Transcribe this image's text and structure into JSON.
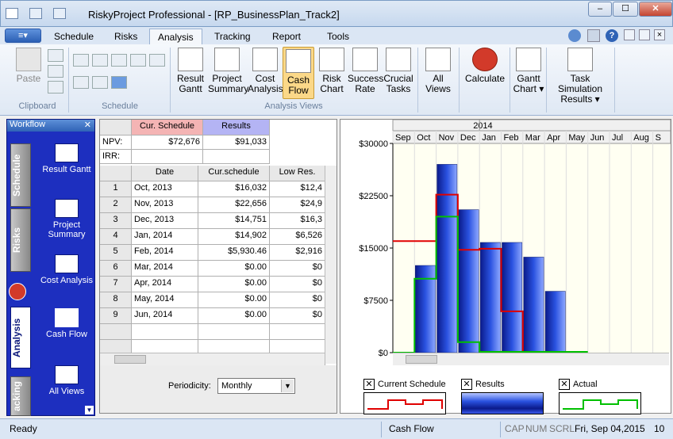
{
  "window": {
    "title": "RiskyProject Professional - [RP_BusinessPlan_Track2]",
    "minimize": "–",
    "maximize": "☐",
    "close": "✕"
  },
  "tabs": [
    "Schedule",
    "Risks",
    "Analysis",
    "Tracking",
    "Report",
    "Tools"
  ],
  "ribbon": {
    "clipboard": {
      "paste": "Paste",
      "group": "Clipboard"
    },
    "schedule_group": "Schedule",
    "views": [
      {
        "l1": "Result",
        "l2": "Gantt"
      },
      {
        "l1": "Project",
        "l2": "Summary"
      },
      {
        "l1": "Cost",
        "l2": "Analysis"
      },
      {
        "l1": "Cash",
        "l2": "Flow"
      },
      {
        "l1": "Risk",
        "l2": "Chart"
      },
      {
        "l1": "Success",
        "l2": "Rate"
      },
      {
        "l1": "Crucial",
        "l2": "Tasks"
      },
      {
        "l1": "All",
        "l2": "Views"
      }
    ],
    "views_group": "Analysis Views",
    "calculate": "Calculate",
    "gantt_chart": {
      "l1": "Gantt",
      "l2": "Chart ▾"
    },
    "task_sim": {
      "l1": "Task Simulation",
      "l2": "Results ▾"
    }
  },
  "workflow": {
    "title": "Workflow",
    "close": "✕",
    "vtabs": [
      "Schedule",
      "Risks",
      "Analysis",
      "acking"
    ],
    "items": [
      "Result Gantt",
      "Project Summary",
      "Cost Analysis",
      "Cash Flow",
      "All Views"
    ]
  },
  "summary": {
    "col1": "Cur. Schedule",
    "col2": "Results",
    "npv_label": "NPV:",
    "npv_cur": "$72,676",
    "npv_res": "$91,033",
    "irr_label": "IRR:"
  },
  "table": {
    "headers": [
      "Date",
      "Cur.schedule",
      "Low Res."
    ],
    "rows": [
      [
        "1",
        "Oct, 2013",
        "$16,032",
        "$12,4"
      ],
      [
        "2",
        "Nov, 2013",
        "$22,656",
        "$24,9"
      ],
      [
        "3",
        "Dec, 2013",
        "$14,751",
        "$16,3"
      ],
      [
        "4",
        "Jan, 2014",
        "$14,902",
        "$6,526"
      ],
      [
        "5",
        "Feb, 2014",
        "$5,930.46",
        "$2,916"
      ],
      [
        "6",
        "Mar, 2014",
        "$0.00",
        "$0"
      ],
      [
        "7",
        "Apr, 2014",
        "$0.00",
        "$0"
      ],
      [
        "8",
        "May, 2014",
        "$0.00",
        "$0"
      ],
      [
        "9",
        "Jun, 2014",
        "$0.00",
        "$0"
      ]
    ]
  },
  "periodicity": {
    "label": "Periodicity:",
    "value": "Monthly"
  },
  "chart_data": {
    "type": "bar",
    "year_label": "2014",
    "categories": [
      "Sep",
      "Oct",
      "Nov",
      "Dec",
      "Jan",
      "Feb",
      "Mar",
      "Apr",
      "May",
      "Jun",
      "Jul",
      "Aug",
      "S"
    ],
    "y_ticks": [
      "$30000",
      "$22500",
      "$15000",
      "$7500",
      "$0"
    ],
    "ylim": [
      0,
      30000
    ],
    "series": [
      {
        "name": "Results",
        "values": [
          0,
          12500,
          27000,
          20500,
          15800,
          15800,
          13700,
          8800,
          0,
          0,
          0,
          0,
          0
        ]
      },
      {
        "name": "Current Schedule",
        "values": [
          16000,
          16000,
          22656,
          14751,
          14902,
          5930,
          0,
          0,
          0,
          0,
          0,
          0,
          0
        ]
      },
      {
        "name": "Actual",
        "values": [
          0,
          10600,
          19500,
          1500,
          0,
          0,
          0,
          0,
          0,
          0,
          0,
          0,
          0
        ]
      }
    ]
  },
  "legend": {
    "current": "Current Schedule",
    "results": "Results",
    "actual": "Actual",
    "check": "✕"
  },
  "status": {
    "ready": "Ready",
    "view": "Cash Flow",
    "cap": "CAP",
    "num": "NUM",
    "scrl": "SCRL",
    "date": "Fri, Sep 04,2015",
    "zoom": "10"
  }
}
